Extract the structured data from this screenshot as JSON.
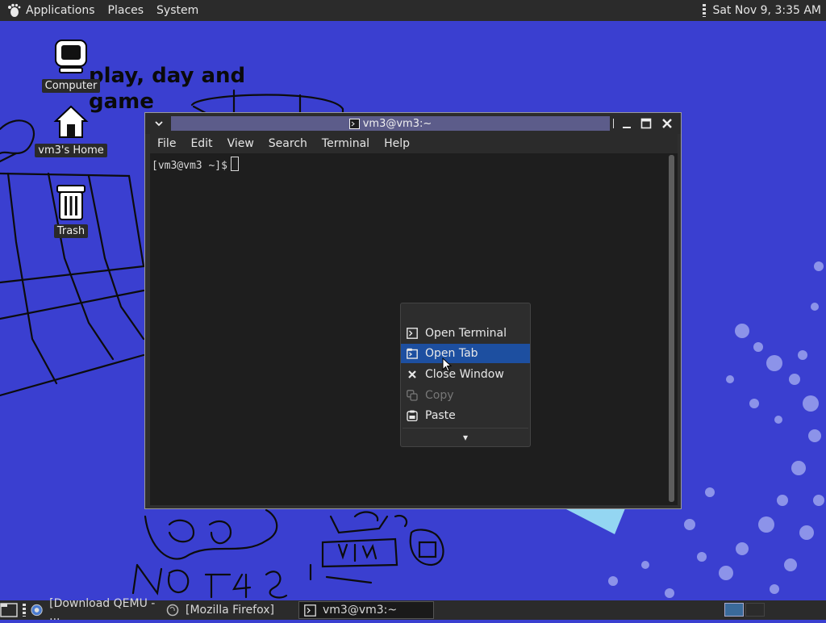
{
  "top_panel": {
    "applications": "Applications",
    "places": "Places",
    "system": "System",
    "clock": "Sat Nov 9, 3:35 AM"
  },
  "desktop": {
    "wallpaper_text_line1": "play, day and",
    "wallpaper_text_line2": "game",
    "icons": [
      {
        "label": "Computer",
        "icon": "computer-icon"
      },
      {
        "label": "vm3's Home",
        "icon": "home-icon"
      },
      {
        "label": "Trash",
        "icon": "trash-icon"
      }
    ]
  },
  "terminal": {
    "title": "vm3@vm3:~",
    "menu": [
      "File",
      "Edit",
      "View",
      "Search",
      "Terminal",
      "Help"
    ],
    "prompt": "[vm3@vm3 ~]$"
  },
  "context_menu": {
    "items": [
      {
        "label": "Open Terminal",
        "icon": "terminal-icon",
        "state": "normal"
      },
      {
        "label": "Open Tab",
        "icon": "open-tab-icon",
        "state": "highlighted"
      },
      {
        "label": "Close Window",
        "icon": "close-window-icon",
        "state": "normal"
      },
      {
        "label": "Copy",
        "icon": "copy-icon",
        "state": "disabled"
      },
      {
        "label": "Paste",
        "icon": "paste-icon",
        "state": "normal"
      }
    ],
    "more": "▾"
  },
  "taskbar": {
    "tasks": [
      {
        "label": "[Download QEMU - ...",
        "icon": "browser-icon"
      },
      {
        "label": "[Mozilla Firefox]",
        "icon": "firefox-icon"
      },
      {
        "label": "vm3@vm3:~",
        "icon": "terminal-icon",
        "active": true
      }
    ]
  },
  "colors": {
    "desktop_blue": "#3a3fd0",
    "panel": "#2b2b2b",
    "highlight": "#1d4fa0"
  }
}
